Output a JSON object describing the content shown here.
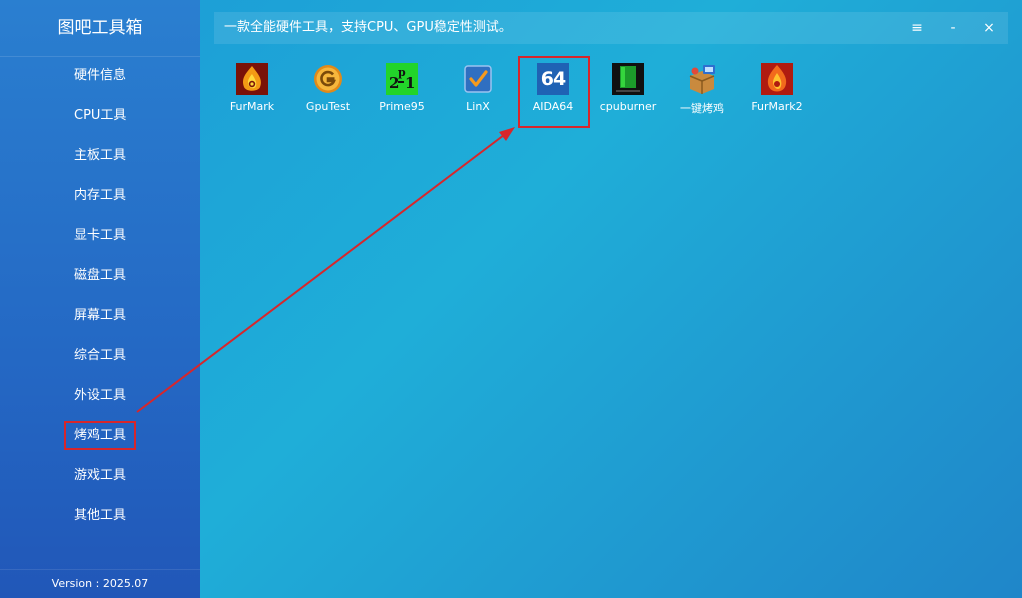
{
  "app": {
    "title": "图吧工具箱",
    "subtitle": "一款全能硬件工具，支持CPU、GPU稳定性测试。",
    "version": "Version : 2025.07"
  },
  "window_controls": {
    "menu": "≡",
    "minimize": "-",
    "close": "×"
  },
  "sidebar": {
    "items": [
      {
        "label": "硬件信息"
      },
      {
        "label": "CPU工具"
      },
      {
        "label": "主板工具"
      },
      {
        "label": "内存工具"
      },
      {
        "label": "显卡工具"
      },
      {
        "label": "磁盘工具"
      },
      {
        "label": "屏幕工具"
      },
      {
        "label": "综合工具"
      },
      {
        "label": "外设工具"
      },
      {
        "label": "烤鸡工具",
        "highlighted": true
      },
      {
        "label": "游戏工具"
      },
      {
        "label": "其他工具"
      }
    ]
  },
  "tools": [
    {
      "label": "FurMark",
      "icon": "furmark-icon"
    },
    {
      "label": "GpuTest",
      "icon": "gputest-icon"
    },
    {
      "label": "Prime95",
      "icon": "prime95-icon"
    },
    {
      "label": "LinX",
      "icon": "linx-icon"
    },
    {
      "label": "AIDA64",
      "icon": "aida64-icon",
      "icon_text": "64",
      "highlighted": true
    },
    {
      "label": "cpuburner",
      "icon": "cpuburner-icon"
    },
    {
      "label": "一键烤鸡",
      "icon": "one-click-burn-icon"
    },
    {
      "label": "FurMark2",
      "icon": "furmark2-icon"
    }
  ],
  "colors": {
    "annotation": "#d8262b",
    "accent": "#1faed8"
  }
}
